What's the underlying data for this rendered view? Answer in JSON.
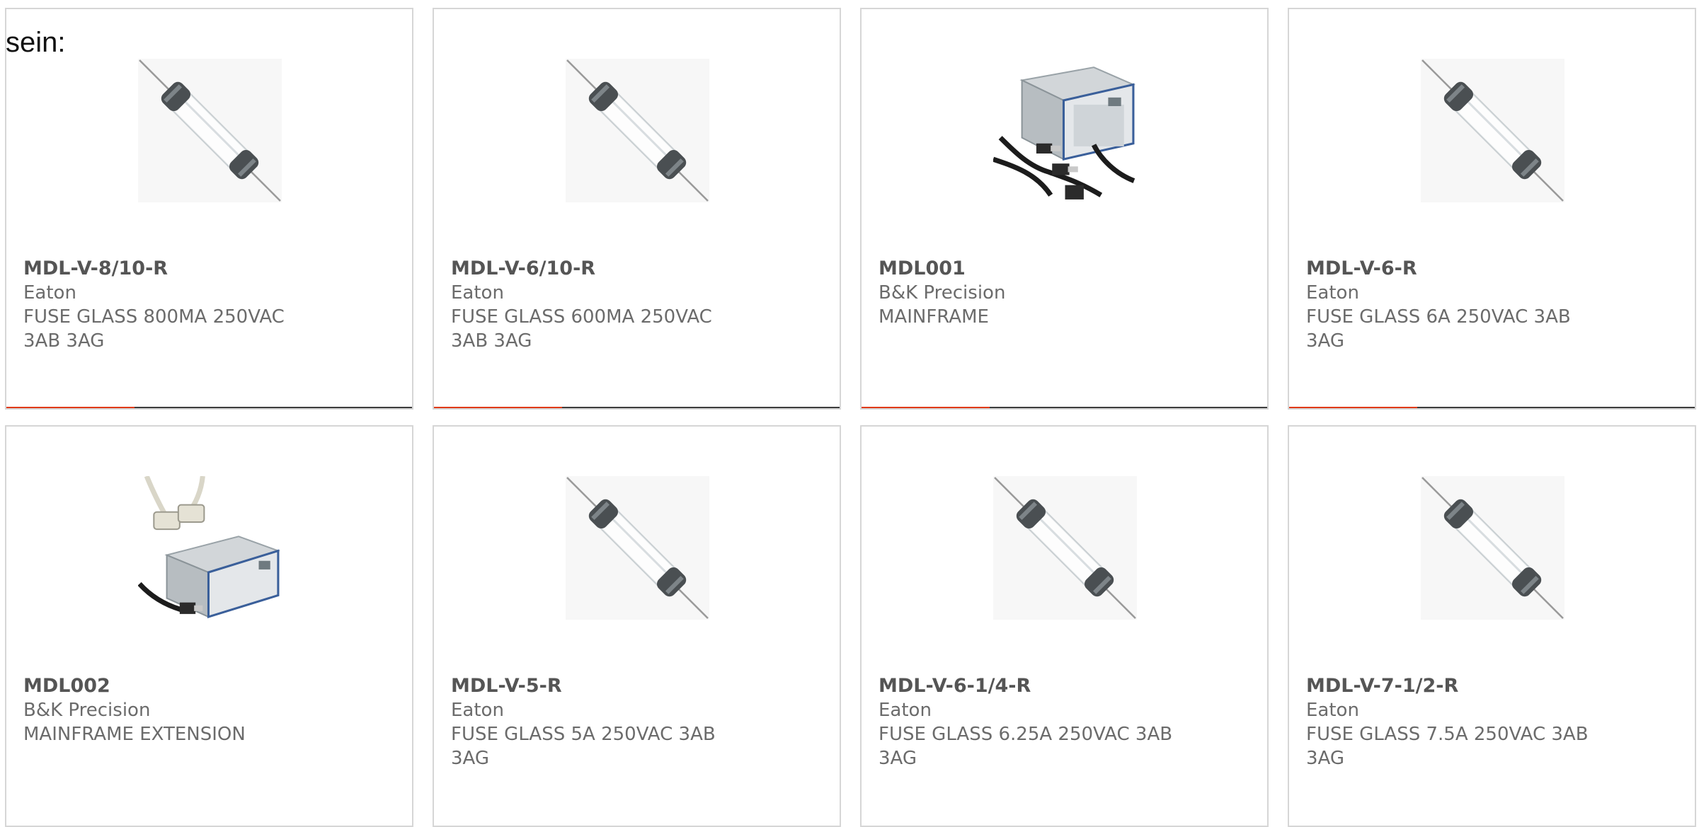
{
  "intro_text": "sein:",
  "accent_color": "#e03a14",
  "products": [
    {
      "part_number": "MDL-V-8/10-R",
      "manufacturer": "Eaton",
      "description": "FUSE GLASS 800MA 250VAC 3AB 3AG",
      "image": "glass-fuse-icon"
    },
    {
      "part_number": "MDL-V-6/10-R",
      "manufacturer": "Eaton",
      "description": "FUSE GLASS 600MA 250VAC 3AB 3AG",
      "image": "glass-fuse-icon"
    },
    {
      "part_number": "MDL001",
      "manufacturer": "B&K Precision",
      "description": "MAINFRAME",
      "image": "mainframe-icon"
    },
    {
      "part_number": "MDL-V-6-R",
      "manufacturer": "Eaton",
      "description": "FUSE GLASS 6A 250VAC 3AB 3AG",
      "image": "glass-fuse-icon"
    },
    {
      "part_number": "MDL002",
      "manufacturer": "B&K Precision",
      "description": "MAINFRAME EXTENSION",
      "image": "mainframe-extension-icon"
    },
    {
      "part_number": "MDL-V-5-R",
      "manufacturer": "Eaton",
      "description": "FUSE GLASS 5A 250VAC 3AB 3AG",
      "image": "glass-fuse-icon"
    },
    {
      "part_number": "MDL-V-6-1/4-R",
      "manufacturer": "Eaton",
      "description": "FUSE GLASS 6.25A 250VAC 3AB 3AG",
      "image": "glass-fuse-icon"
    },
    {
      "part_number": "MDL-V-7-1/2-R",
      "manufacturer": "Eaton",
      "description": "FUSE GLASS 7.5A 250VAC 3AB 3AG",
      "image": "glass-fuse-icon"
    }
  ]
}
